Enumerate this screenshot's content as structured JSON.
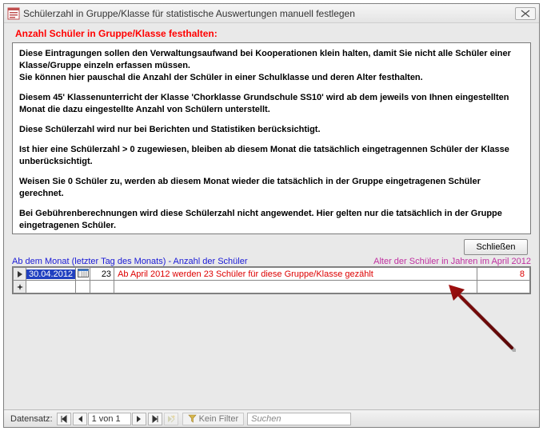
{
  "window": {
    "title": "Schülerzahl in Gruppe/Klasse für statistische Auswertungen manuell festlegen"
  },
  "caption": "Anzahl Schüler in Gruppe/Klasse festhalten:",
  "info": {
    "p1": "Diese Eintragungen sollen den Verwaltungsaufwand bei Kooperationen klein halten, damit Sie nicht alle Schüler einer Klasse/Gruppe einzeln erfassen müssen.",
    "p2": "Sie können hier pauschal die Anzahl der Schüler in einer Schulklasse und deren Alter festhalten.",
    "p3": "Diesem 45' Klassenunterricht der Klasse 'Chorklasse Grundschule SS10' wird ab dem jeweils von Ihnen eingestellten Monat die dazu eingestellte Anzahl von Schülern unterstellt.",
    "p4": "Diese Schülerzahl wird nur bei Berichten und Statistiken berücksichtigt.",
    "p5": "Ist hier eine Schülerzahl > 0 zugewiesen, bleiben ab diesem Monat die tatsächlich eingetragennen Schüler der Klasse unberücksichtigt.",
    "p6": "Weisen Sie 0 Schüler zu, werden ab diesem Monat wieder die tatsächlich in der Gruppe eingetragenen Schüler gerechnet.",
    "p7": "Bei Gebührenberechnungen wird diese Schülerzahl nicht angewendet. Hier gelten nur die tatsächlich in der Gruppe eingetragenen Schüler."
  },
  "buttons": {
    "close": "Schließen"
  },
  "columns": {
    "left": "Ab dem Monat (letzter Tag des Monats) - Anzahl der Schüler",
    "right": "Alter der Schüler in Jahren im April 2012"
  },
  "rows": [
    {
      "date": "30.04.2012",
      "count": "23",
      "message": "Ab April 2012 werden 23 Schüler für diese Gruppe/Klasse gezählt",
      "age": "8"
    }
  ],
  "nav": {
    "label": "Datensatz:",
    "position": "1 von 1",
    "filter": "Kein Filter",
    "search_placeholder": "Suchen"
  }
}
